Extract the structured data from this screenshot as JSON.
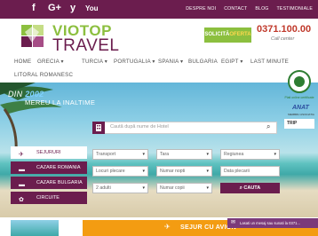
{
  "topbar": {
    "social": [
      "f",
      "G+",
      "y",
      "You"
    ],
    "links": [
      "DESPRE NOI",
      "CONTACT",
      "BLOG",
      "TESTIMONIALE"
    ]
  },
  "header": {
    "logo_line1": "VIOTOP",
    "logo_line2": "TRAVEL",
    "offer_word1": "SOLICITĂ",
    "offer_word2": "OFERTA",
    "phone": "0371.100.00",
    "callcenter": "Call center"
  },
  "nav": {
    "items": [
      "HOME",
      "GRECIA ▾",
      "TURCIA ▾",
      "PORTUGALIA ▾",
      "SPANIA ▾",
      "BULGARIA",
      "EGIPT ▾",
      "LAST MINUTE",
      "LITORAL ROMANESC"
    ]
  },
  "hero": {
    "title_prefix": "DIN",
    "title_year": "2002",
    "title_line2": "MEREU LA INALTIME",
    "search_placeholder": "Caută după nume de Hotel"
  },
  "sidebar": {
    "items": [
      {
        "label": "SEJURURI",
        "icon": "✈"
      },
      {
        "label": "CAZARE ROMANIA",
        "icon": "▬"
      },
      {
        "label": "CAZARE BULGARIA",
        "icon": "▬"
      },
      {
        "label": "CIRCUITE",
        "icon": "✿"
      }
    ]
  },
  "form": {
    "transport": "Transport",
    "tara": "Tara",
    "regiunea": "Regiunea",
    "locuri": "Locuri plecare",
    "nopti": "Numar nopti",
    "data": "Data plecarii",
    "adulti": "2 adulti",
    "copii": "Numar copii",
    "search_btn": "CAUTA"
  },
  "badges": {
    "caption": "Plati online certificate",
    "anat": "ANAT",
    "anat_sub": "MEMBRU ASOCIATIA",
    "trip": "TRIP"
  },
  "bottom": {
    "banner_title": "SEJUR CU AVION",
    "chat": "Lasati un mesaj sau sunati la 0371..."
  },
  "colors": {
    "brand_purple": "#6b1d4e",
    "brand_green": "#8cbf3f",
    "accent_orange": "#f39c12"
  }
}
